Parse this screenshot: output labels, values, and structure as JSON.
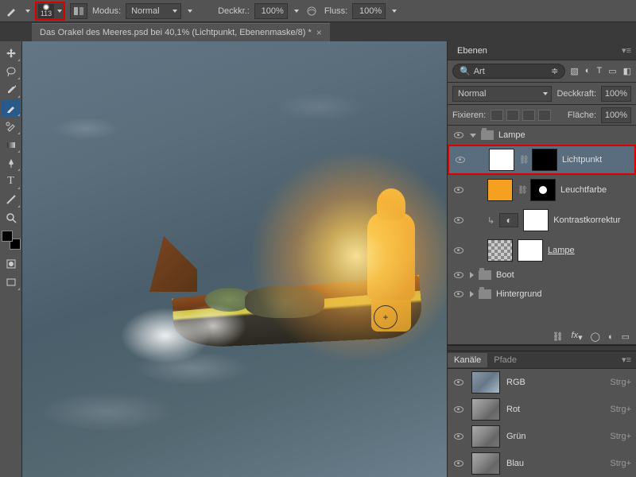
{
  "top": {
    "brush_size": "113",
    "mode_label": "Modus:",
    "mode_value": "Normal",
    "opacity_label": "Deckkr.:",
    "opacity_value": "100%",
    "flow_label": "Fluss:",
    "flow_value": "100%"
  },
  "document": {
    "tab_title": "Das Orakel des Meeres.psd bei 40,1%  (Lichtpunkt, Ebenenmaske/8) *"
  },
  "panels": {
    "layers_title": "Ebenen",
    "search_placeholder": "Art",
    "blend_mode": "Normal",
    "opacity_label": "Deckkraft:",
    "opacity_value": "100%",
    "lock_label": "Fixieren:",
    "fill_label": "Fläche:",
    "fill_value": "100%",
    "groups": {
      "lampe": "Lampe",
      "boot": "Boot",
      "hintergrund": "Hintergrund"
    },
    "layers": {
      "lichtpunkt": "Lichtpunkt",
      "leuchtfarbe": "Leuchtfarbe",
      "kontrast": "Kontrastkorrektur",
      "lampe_link": "Lampe "
    },
    "channels_tab": "Kanäle",
    "paths_tab": "Pfade",
    "channels": [
      {
        "name": "RGB",
        "shortcut": "Strg+"
      },
      {
        "name": "Rot",
        "shortcut": "Strg+"
      },
      {
        "name": "Grün",
        "shortcut": "Strg+"
      },
      {
        "name": "Blau",
        "shortcut": "Strg+"
      }
    ],
    "fx_label": "fx"
  }
}
